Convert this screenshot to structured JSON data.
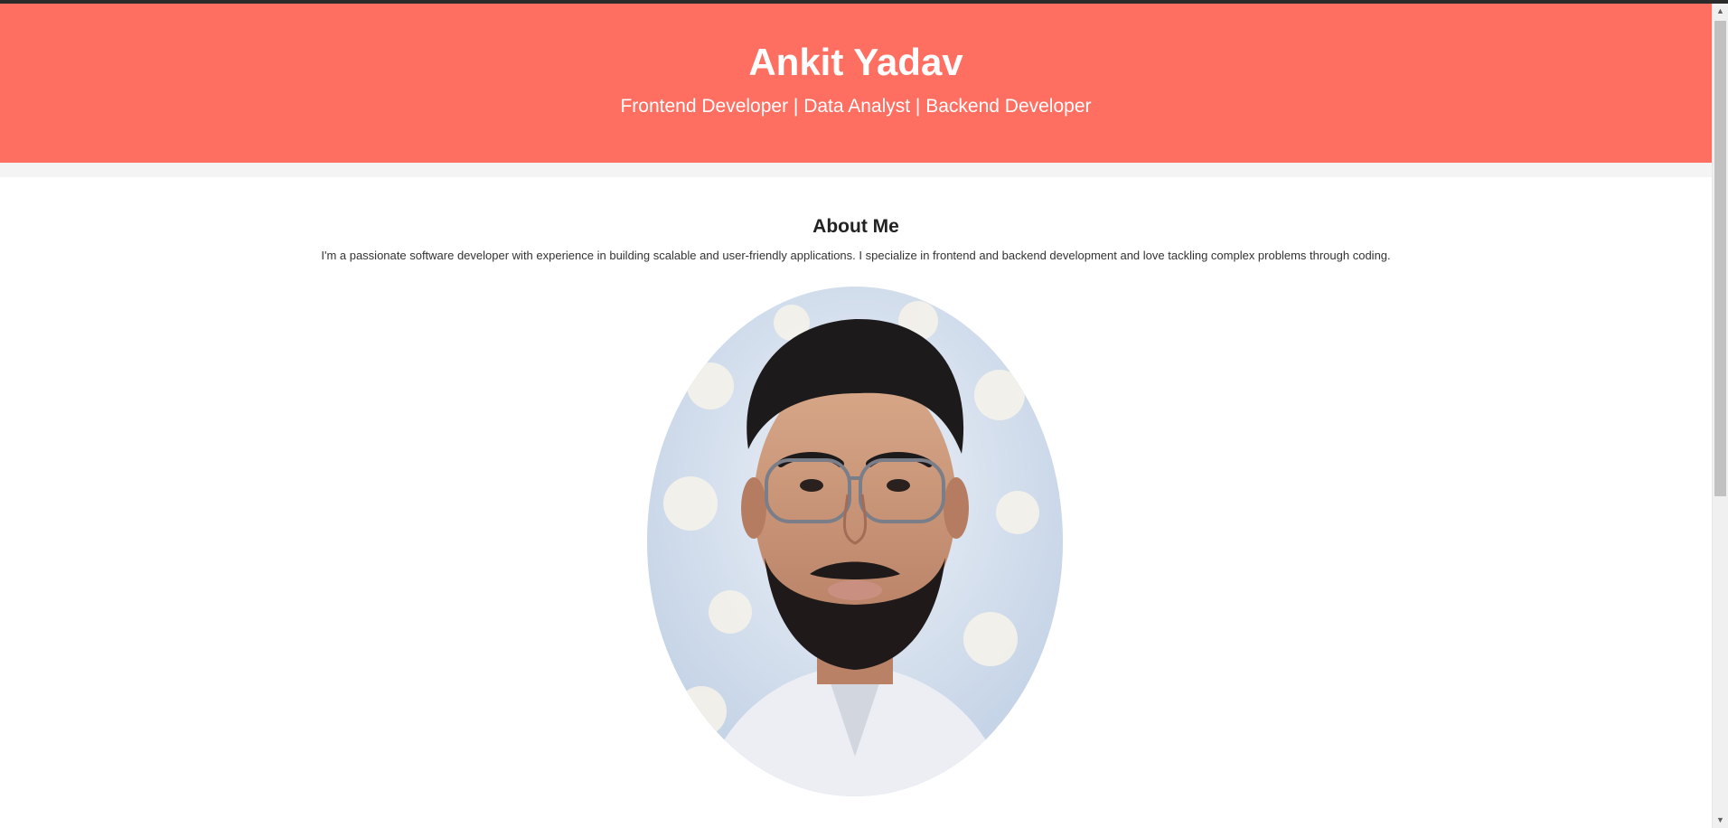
{
  "hero": {
    "name": "Ankit Yadav",
    "roles": "Frontend Developer | Data Analyst | Backend Developer"
  },
  "about": {
    "heading": "About Me",
    "bio": "I'm a passionate software developer with experience in building scalable and user-friendly applications. I specialize in frontend and backend development and love tackling complex problems through coding."
  },
  "colors": {
    "hero_bg": "#ff6f61",
    "hero_text": "#ffffff",
    "page_bg": "#f4f4f4",
    "section_bg": "#ffffff"
  },
  "icons": {
    "scroll_up": "▲",
    "scroll_down": "▼"
  },
  "scroll_position": 0
}
